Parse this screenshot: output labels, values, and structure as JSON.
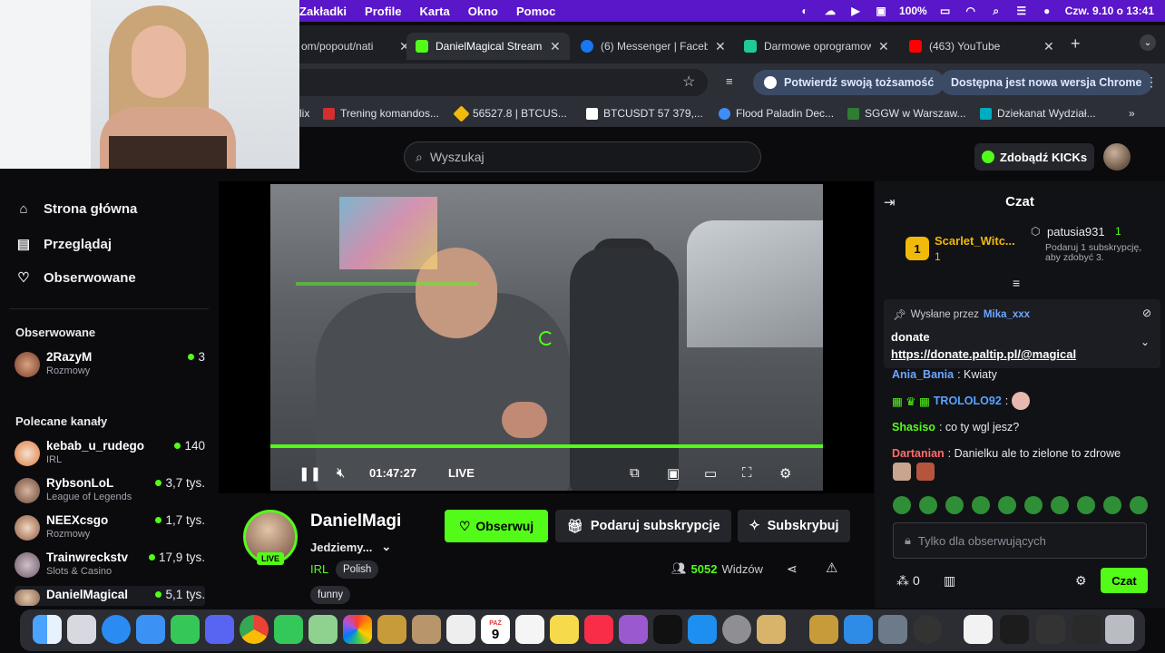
{
  "menubar": {
    "menus": [
      "Zakładki",
      "Profile",
      "Karta",
      "Okno",
      "Pomoc"
    ],
    "battery": "100%",
    "clock": "Czw. 9.10 o 13:41"
  },
  "tabs": [
    {
      "title": "om/popout/nati",
      "color": "#888888"
    },
    {
      "title": "DanielMagical Stream",
      "color": "#53fc18"
    },
    {
      "title": "(6) Messenger | Facebook",
      "color": "#1877f2"
    },
    {
      "title": "Darmowe oprogramowanie",
      "color": "#20c997"
    },
    {
      "title": "(463) YouTube",
      "color": "#ff0000"
    }
  ],
  "toolbar": {
    "identity_pill": "Potwierdź swoją tożsamość",
    "update_pill": "Dostępna jest nowa wersja Chrome"
  },
  "bookmarks": [
    {
      "label": "lix",
      "color": "#e50914"
    },
    {
      "label": "Trening komandos...",
      "color": "#d32f2f"
    },
    {
      "label": "56527.8 | BTCUS...",
      "color": "#f0b90b"
    },
    {
      "label": "BTCUSDT 57 379,...",
      "color": "#ffffff"
    },
    {
      "label": "Flood Paladin Dec...",
      "color": "#3f8ef5"
    },
    {
      "label": "SGGW w Warszaw...",
      "color": "#2e7d32"
    },
    {
      "label": "Dziekanat Wydział...",
      "color": "#00acc1"
    }
  ],
  "header": {
    "search_placeholder": "Wyszukaj",
    "kicks_label": "Zdobądź KICKs"
  },
  "sidebar": {
    "nav": [
      {
        "label": "Strona główna",
        "icon": "home-icon"
      },
      {
        "label": "Przeglądaj",
        "icon": "browse-icon"
      },
      {
        "label": "Obserwowane",
        "icon": "heart-icon"
      }
    ],
    "following_title": "Obserwowane",
    "following": [
      {
        "name": "2RazyM",
        "category": "Rozmowy",
        "viewers": "3"
      }
    ],
    "recommended_title": "Polecane kanały",
    "recommended": [
      {
        "name": "kebab_u_rudego",
        "category": "IRL",
        "viewers": "140"
      },
      {
        "name": "RybsonLoL",
        "category": "League of Legends",
        "viewers": "3,7 tys."
      },
      {
        "name": "NEEXcsgo",
        "category": "Rozmowy",
        "viewers": "1,7 tys."
      },
      {
        "name": "Trainwreckstv",
        "category": "Slots & Casino",
        "viewers": "17,9 tys."
      },
      {
        "name": "DanielMagical",
        "category": "",
        "viewers": "5,1 tys."
      }
    ]
  },
  "player": {
    "time": "01:47:27",
    "live_label": "LIVE"
  },
  "stream": {
    "streamer": "DanielMagi",
    "title": "Jedziemy...",
    "category": "IRL",
    "tags": [
      "Polish",
      "funny"
    ],
    "live_badge": "LIVE",
    "viewers_count": "5052",
    "viewers_label": "Widzów",
    "follow_label": "Obserwuj",
    "gift_label": "Podaruj subskrypcje",
    "subscribe_label": "Subskrybuj"
  },
  "chat": {
    "title": "Czat",
    "top_gifter_1": {
      "rank": "1",
      "name": "Scarlet_Witc...",
      "count": "1"
    },
    "top_gifter_2": {
      "name": "patusia931",
      "count": "1",
      "hint": "Podaruj 1 subskrypcję, aby zdobyć 3."
    },
    "pinned": {
      "by_label": "Wysłane przez",
      "by_user": "Mika_xxx",
      "line1": "donate",
      "line2": "https://donate.paltip.pl/@magical"
    },
    "messages": [
      {
        "user": "Ania_Bania",
        "color": "#6ea7ff",
        "text": ": Kwiaty"
      },
      {
        "user": "TROLOLO92",
        "color": "#5aa2ff",
        "text": ":"
      },
      {
        "user": "Shasiso",
        "color": "#53fc18",
        "text": ": co ty wgl jesz?"
      },
      {
        "user": "Dartanian",
        "color": "#ff6b6b",
        "text": ": Danielku ale to zielone to zdrowe"
      }
    ],
    "input_placeholder": "Tylko dla obserwujących",
    "kicks_count": "0",
    "send_label": "Czat"
  },
  "dock": {
    "icons": [
      "finder-icon",
      "launchpad-icon",
      "safari-icon",
      "mail-icon",
      "facetime-icon",
      "discord-icon",
      "chrome-icon",
      "messages-icon",
      "maps-icon",
      "photos-icon",
      "app-icon",
      "contacts-icon",
      "screenshot-icon",
      "calendar-icon",
      "reminders-icon",
      "notes-icon",
      "music-icon",
      "podcasts-icon",
      "tv-icon",
      "appstore-icon",
      "settings-icon",
      "archive-icon",
      "app2-icon",
      "xcode-icon",
      "monitor-icon",
      "activity-icon",
      "file-icon",
      "window-icon",
      "window2-icon",
      "window3-icon",
      "trash-icon"
    ],
    "calendar_day": "9",
    "calendar_month": "PAŹ"
  }
}
